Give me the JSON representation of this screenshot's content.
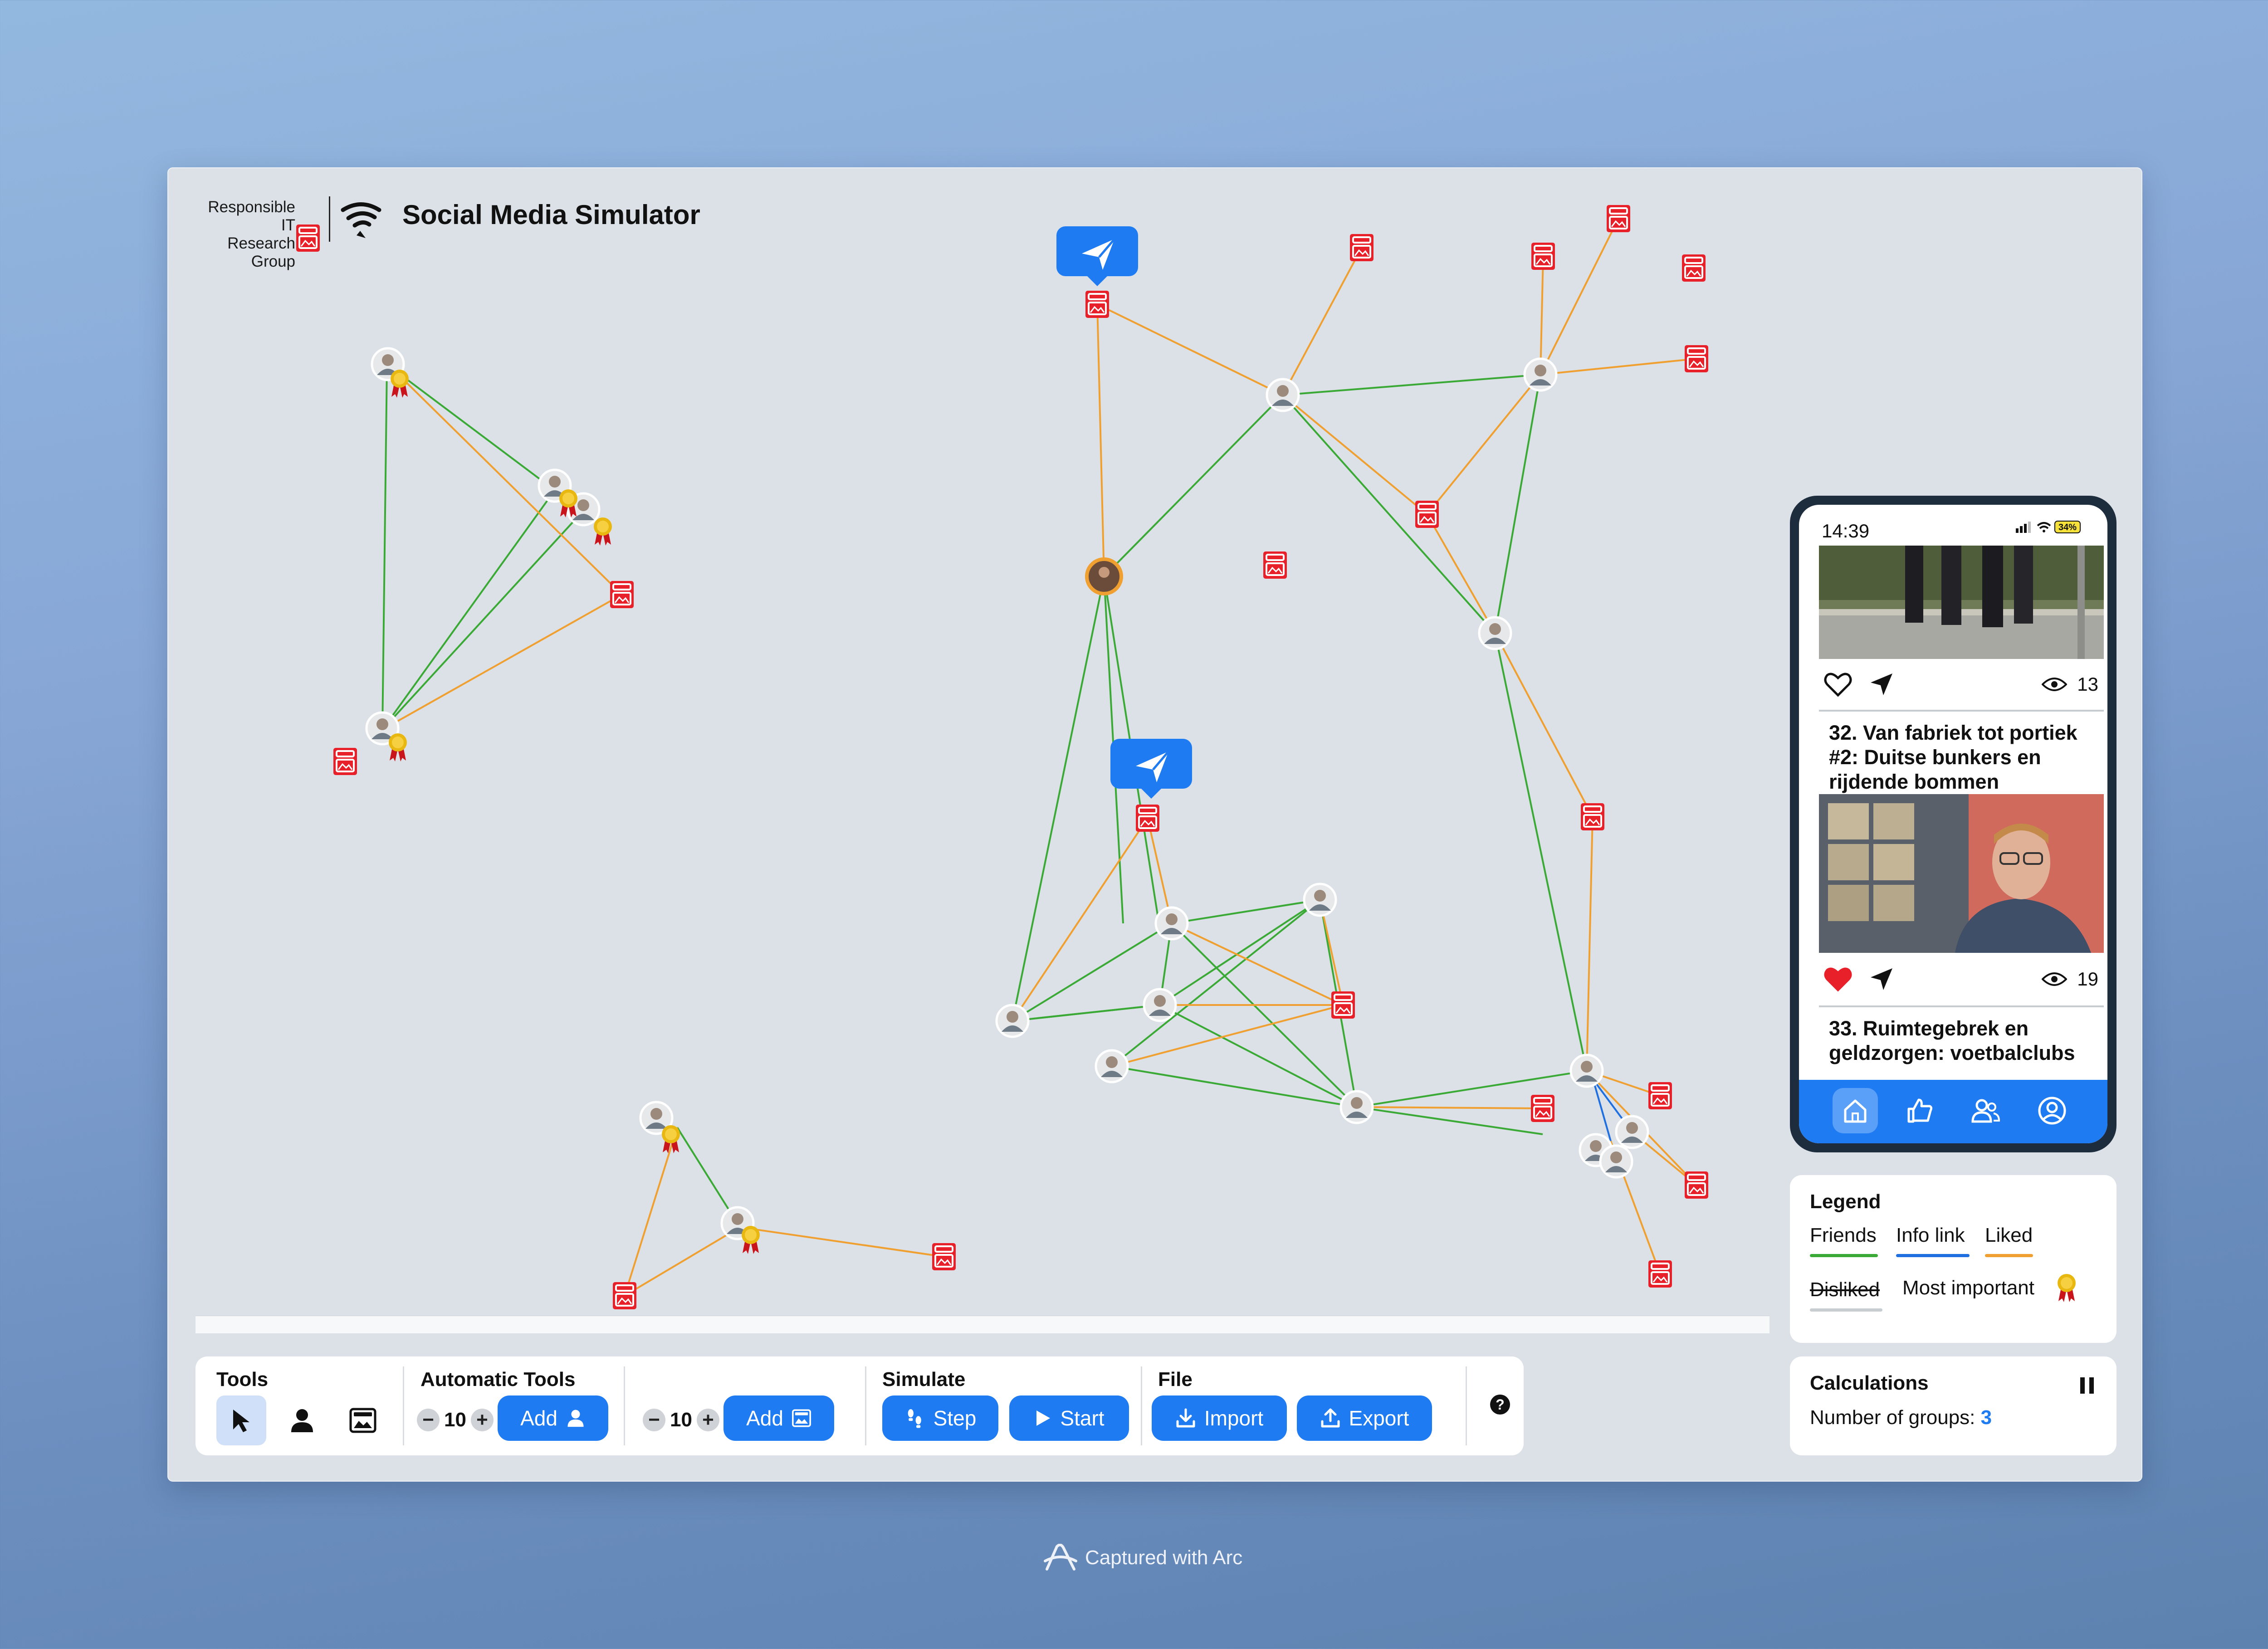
{
  "header": {
    "brand_line1": "Responsible IT",
    "brand_line2": "Research Group",
    "title": "Social Media Simulator"
  },
  "toolbar": {
    "tools_title": "Tools",
    "automatic_title": "Automatic Tools",
    "user_count": "10",
    "post_count": "10",
    "add_user_label": "Add",
    "add_post_label": "Add",
    "simulate_title": "Simulate",
    "step_label": "Step",
    "start_label": "Start",
    "file_title": "File",
    "import_label": "Import",
    "export_label": "Export",
    "minus": "−",
    "plus": "+",
    "help": "?"
  },
  "phone": {
    "time": "14:39",
    "battery": "34%",
    "posts": [
      {
        "views": "13",
        "liked": false,
        "title": "32. Van fabriek tot portiek #2: Duitse bunkers en rijdende bommen"
      },
      {
        "views": "19",
        "liked": true,
        "title": "33. Ruimtegebrek en geldzorgen: voetbalclubs"
      }
    ],
    "nav": [
      "home-icon",
      "thumbs-up-icon",
      "friends-icon",
      "profile-icon"
    ]
  },
  "legend": {
    "title": "Legend",
    "friends": "Friends",
    "info_link": "Info link",
    "liked": "Liked",
    "disliked": "Disliked",
    "most_important": "Most important",
    "colors": {
      "friends": "#3aa935",
      "info_link": "#1f6fe0",
      "liked": "#f0a030",
      "disliked": "#c8cdd2"
    }
  },
  "calculations": {
    "title": "Calculations",
    "groups_label": "Number of groups:",
    "groups_value": "3"
  },
  "footer": {
    "captured": "Captured with Arc"
  },
  "colors": {
    "accent": "#1f7bf2",
    "post_icon": "#e8202a",
    "friend_edge": "#3aa935",
    "like_edge": "#f0a030"
  }
}
